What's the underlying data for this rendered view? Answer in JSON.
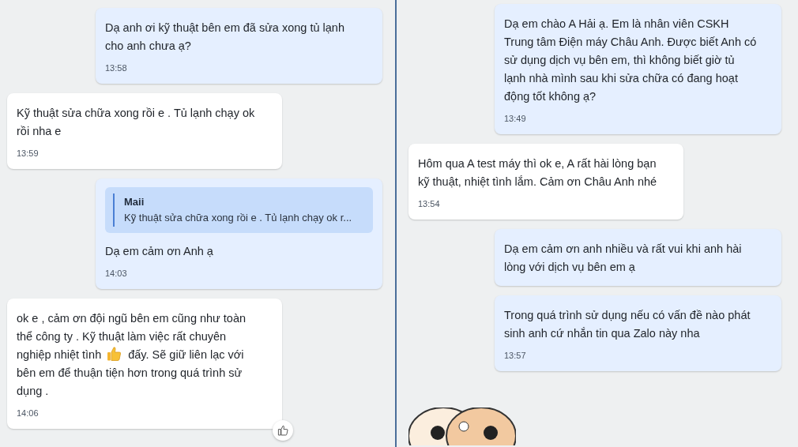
{
  "panels": [
    {
      "messages": [
        {
          "outgoing": true,
          "segments": [
            {
              "kind": "text",
              "text": "Dạ anh ơi kỹ thuật bên em đã sửa xong tủ lạnh cho anh chưa ạ?"
            }
          ],
          "time": "13:58"
        },
        {
          "outgoing": false,
          "segments": [
            {
              "kind": "text",
              "text": "Kỹ thuật sửa chữa xong rồi e . Tủ lạnh chạy ok rồi nha e"
            }
          ],
          "time": "13:59"
        },
        {
          "outgoing": true,
          "quote": {
            "author": "Maii",
            "text": "Kỹ thuật sửa chữa xong rồi e . Tủ lạnh chạy ok r..."
          },
          "segments": [
            {
              "kind": "text",
              "text": "Dạ em cảm ơn Anh ạ"
            }
          ],
          "time": "14:03"
        },
        {
          "outgoing": false,
          "segments": [
            {
              "kind": "text",
              "text": "ok e , cảm ơn đội ngũ bên em cũng như toàn thể công ty . Kỹ thuật làm việc rất chuyên nghiệp nhiệt tình"
            },
            {
              "kind": "emoji"
            },
            {
              "kind": "text",
              "text": "đấy. Sẽ giữ liên lạc với bên em để thuận tiện hơn trong quá trình sử dụng ."
            }
          ],
          "time": "14:06",
          "like_button": true
        }
      ]
    },
    {
      "messages": [
        {
          "outgoing": true,
          "segments": [
            {
              "kind": "text",
              "text": "Dạ em chào A Hải ạ. Em là nhân viên CSKH Trung tâm Điện máy Châu Anh. Được biết Anh có sử dụng dịch vụ bên em, thì không biết giờ tủ lạnh nhà mình sau khi sửa chữa có đang hoạt động tốt không ạ?"
            }
          ],
          "time": "13:49"
        },
        {
          "outgoing": false,
          "segments": [
            {
              "kind": "text",
              "text": "Hôm qua A test máy thì ok e, A rất hài lòng bạn kỹ thuật, nhiệt tình lắm. Cảm ơn Châu Anh nhé"
            }
          ],
          "time": "13:54"
        },
        {
          "outgoing": true,
          "segments": [
            {
              "kind": "text",
              "text": "Dạ em cảm ơn anh nhiều và rất vui khi anh hài lòng với dịch vụ bên em ạ"
            }
          ]
        },
        {
          "outgoing": true,
          "segments": [
            {
              "kind": "text",
              "text": "Trong quá trình sử dụng nếu có vấn đề nào phát sinh anh cứ nhắn tin qua Zalo này nha"
            }
          ],
          "time": "13:57"
        },
        {
          "outgoing": false,
          "kind": "sticker"
        }
      ]
    }
  ]
}
